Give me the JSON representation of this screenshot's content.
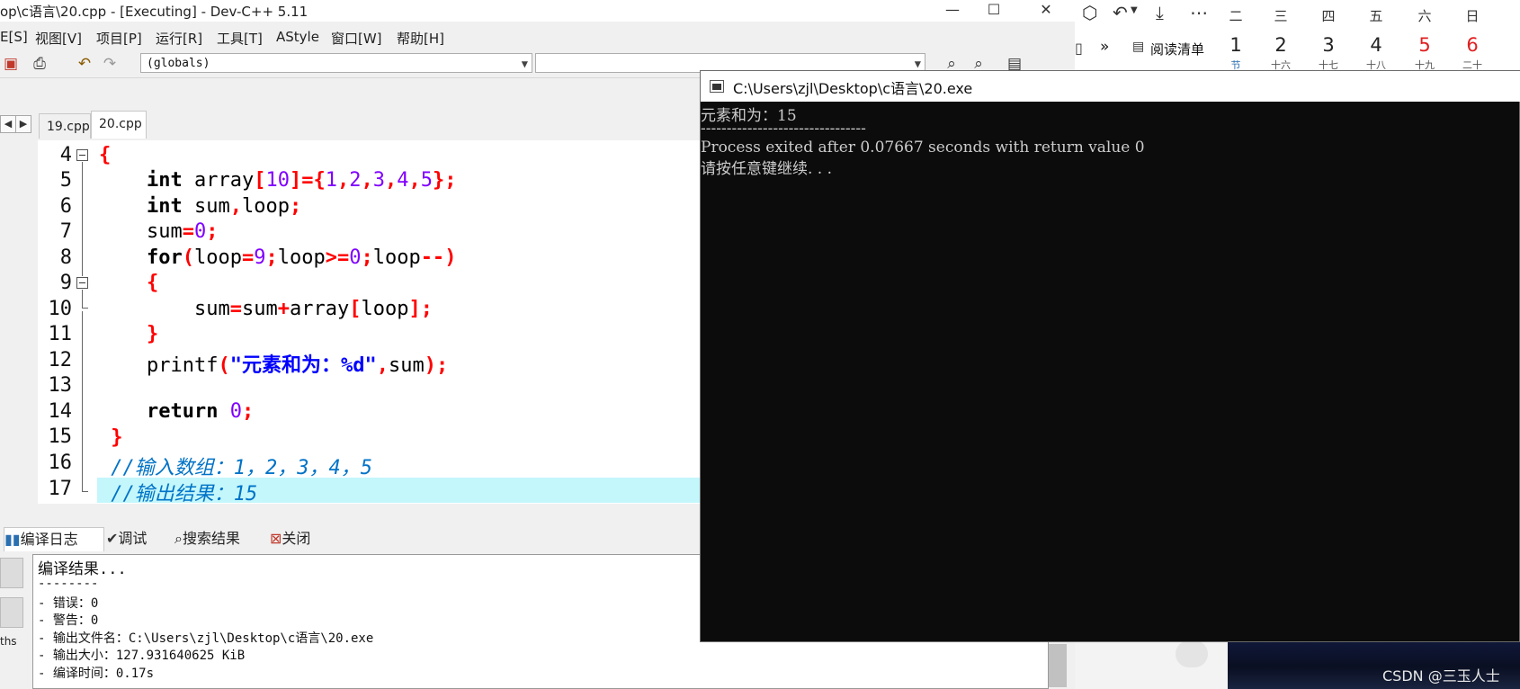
{
  "devcpp": {
    "title": "op\\c语言\\20.cpp - [Executing] - Dev-C++ 5.11",
    "window_buttons": [
      "—",
      "☐",
      "✕"
    ],
    "menu": [
      "E[S]",
      "视图[V]",
      "项目[P]",
      "运行[R]",
      "工具[T]",
      "AStyle",
      "窗口[W]",
      "帮助[H]"
    ],
    "toolbar": {
      "scope_combo": "(globals)",
      "symbol_combo": ""
    },
    "tabs": [
      "19.cpp",
      "20.cpp"
    ],
    "active_tab": "20.cpp",
    "editor": {
      "line_numbers": [
        "4",
        "5",
        "6",
        "7",
        "8",
        "9",
        "10",
        "11",
        "12",
        "13",
        "14",
        "15",
        "16",
        "17"
      ],
      "highlighted_line": "17",
      "line5": {
        "indent": "    ",
        "kw": "int",
        "name": " array",
        "idx_open": "[",
        "size": "10",
        "idx_close": "]",
        "eq": "=",
        "brace_open": "{",
        "v1": "1",
        "c1": ",",
        "v2": "2",
        "c2": ",",
        "v3": "3",
        "c3": ",",
        "v4": "4",
        "c4": ",",
        "v5": "5",
        "brace_close": "}",
        "semi": ";"
      },
      "line6": {
        "indent": "    ",
        "kw": "int",
        "name1": " sum",
        "comma": ",",
        "name2": "loop",
        "semi": ";"
      },
      "line7": {
        "indent": "    ",
        "name": "sum",
        "eq": "=",
        "value": "0",
        "semi": ";"
      },
      "line8": {
        "indent": "    ",
        "kw": "for",
        "p_open": "(",
        "v1": "loop",
        "eq": "=",
        "n1": "9",
        "s1": ";",
        "v2": "loop",
        "ge": ">=",
        "n2": "0",
        "s2": ";",
        "v3": "loop",
        "dec": "--",
        "p_close": ")"
      },
      "line9": {
        "indent": "    ",
        "brace": "{"
      },
      "line10": {
        "indent": "        ",
        "lhs": "sum",
        "eq": "=",
        "t1": "sum",
        "plus": "+",
        "t2": "array",
        "b_open": "[",
        "idx": "loop",
        "b_close": "]",
        "semi": ";"
      },
      "line11": {
        "indent": "    ",
        "brace": "}"
      },
      "line12": {
        "indent": "    ",
        "fn": "printf",
        "p_open": "(",
        "str": "\"元素和为：%d\"",
        "comma": ",",
        "arg": "sum",
        "p_close": ")",
        "semi": ";"
      },
      "line14": {
        "indent": "    ",
        "kw": "return",
        "space": " ",
        "value": "0",
        "semi": ";"
      },
      "line4": {
        "brace": "{"
      },
      "line15": {
        "indent": " ",
        "brace": "}"
      },
      "line16": {
        "indent": " ",
        "comment": "//输入数组：1，2，3，4，5"
      },
      "line17": {
        "indent": " ",
        "comment": "//输出结果：15"
      }
    },
    "bottom_tabs": [
      "编译日志",
      "调试",
      "搜索结果",
      "关闭"
    ],
    "bottom_left_label": "ths",
    "compile_log": [
      "编译结果...",
      "--------",
      "- 错误：0",
      "- 警告：0",
      "- 输出文件名：C:\\Users\\zjl\\Desktop\\c语言\\20.exe",
      "- 输出大小：127.931640625 KiB",
      "- 编译时间：0.17s"
    ]
  },
  "console": {
    "title": "C:\\Users\\zjl\\Desktop\\c语言\\20.exe",
    "lines": [
      "元素和为：15",
      "--------------------------------",
      "Process exited after 0.07667 seconds with return value 0",
      "请按任意键继续. . ."
    ]
  },
  "browser": {
    "more_label": "»",
    "reading_list_label": "阅读清单",
    "left_glyph": "▯"
  },
  "calendar": {
    "weekdays": [
      "二",
      "三",
      "四",
      "五",
      "六",
      "日"
    ],
    "days": [
      "1",
      "2",
      "3",
      "4",
      "5",
      "6"
    ],
    "red_days": [
      "5",
      "6"
    ],
    "lunar": [
      "节",
      "十六",
      "十七",
      "十八",
      "十九",
      "二十"
    ]
  },
  "watermark": "CSDN @三玉人士"
}
